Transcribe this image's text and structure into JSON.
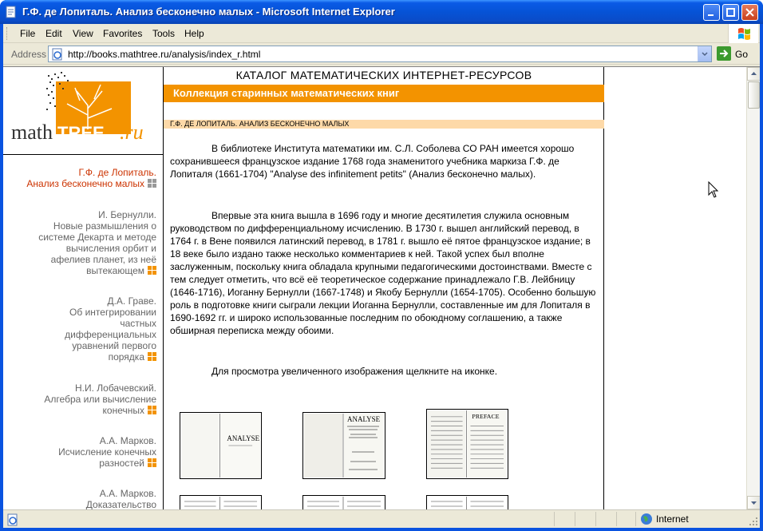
{
  "window": {
    "title": "Г.Ф. де Лопиталь. Анализ бесконечно малых - Microsoft Internet Explorer"
  },
  "menu": {
    "items": [
      "File",
      "Edit",
      "View",
      "Favorites",
      "Tools",
      "Help"
    ]
  },
  "address": {
    "label": "Address",
    "url": "http://books.mathtree.ru/analysis/index_r.html",
    "go_label": "Go"
  },
  "logo": {
    "text_math": "math",
    "text_tree": "TREE",
    "text_ru": ".ru"
  },
  "sidebar": {
    "items": [
      {
        "lines": [
          "Г.Ф. де Лопиталь.",
          "Анализ бесконечно малых"
        ],
        "active": true
      },
      {
        "lines": [
          "И. Бернулли.",
          "Новые размышления о",
          "системе Декарта и методе",
          "вычисления орбит и",
          "афелиев планет, из неё",
          "вытекающем"
        ],
        "active": false
      },
      {
        "lines": [
          "Д.А. Граве.",
          "Об интегрировании",
          "частных",
          "дифференциальных",
          "уравнений первого",
          "порядка"
        ],
        "active": false
      },
      {
        "lines": [
          "Н.И. Лобачевский.",
          "Алгебра или вычисление",
          "конечных"
        ],
        "active": false
      },
      {
        "lines": [
          "А.А. Марков.",
          "Исчисление конечных",
          "разностей"
        ],
        "active": false
      },
      {
        "lines": [
          "А.А. Марков.",
          "Доказательство"
        ],
        "active": false
      }
    ]
  },
  "content": {
    "catalog_title": "КАТАЛОГ МАТЕМАТИЧЕСКИХ ИНТЕРНЕТ-РЕСУРСОВ",
    "collection_title": "Коллекция старинных математических книг",
    "book_title": "Г.Ф. ДЕ ЛОПИТАЛЬ. АНАЛИЗ БЕСКОНЕЧНО МАЛЫХ",
    "para1": "В библиотеке Института математики им. С.Л. Соболева СО РАН  имеется хорошо сохранившееся французское издание 1768 года знаменитого учебника маркиза Г.Ф. де Лопиталя (1661-1704) \"Analyse des infinitement petits\" (Анализ бесконечно малых).",
    "para2": "Впервые эта книга вышла в 1696 году и многие десятилетия служила основным руководством по дифференциальному исчислению. В 1730 г. вышел английский перевод, в 1764 г. в Вене появился латинский перевод, в 1781 г. вышло её пятое французское издание; в 18 веке было издано также несколько комментариев к ней. Такой успех был вполне заслуженным, поскольку книга обладала крупными педагогическими достоинствами. Вместе с тем следует отметить, что всё её теоретическое содержание принадлежало Г.В. Лейбницу (1646-1716),  Иоганну Бернулли (1667-1748) и Якобу Бернулли (1654-1705). Особенно большую роль в подготовке книги сыграли лекции Иоганна Бернулли, составленные им для Лопиталя в 1690-1692 гг. и широко использованные последним по обоюдному соглашению, а также обширная переписка между обоими.",
    "para3": "Для просмотра увеличенного изображения щелкните на иконке.",
    "thumb1_text": "ANALYSE",
    "thumb2_text": "ANALYSE",
    "thumb3_text": "PREFACE"
  },
  "status": {
    "zone": "Internet"
  },
  "colors": {
    "orange": "#f39300",
    "peach": "#fdd9a8",
    "active_link": "#cc3300",
    "link_gray": "#666666",
    "nav_square": "#f39300"
  }
}
